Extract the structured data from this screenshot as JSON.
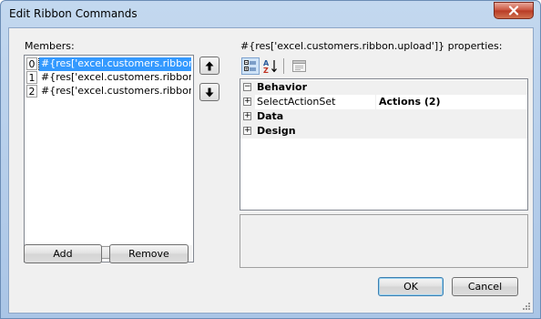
{
  "window": {
    "title": "Edit Ribbon Commands"
  },
  "members": {
    "label": "Members:",
    "items": [
      {
        "index": "0",
        "text": "#{res['excel.customers.ribbon.upl"
      },
      {
        "index": "1",
        "text": "#{res['excel.customers.ribbon.del"
      },
      {
        "index": "2",
        "text": "#{res['excel.customers.ribbon.dov"
      }
    ],
    "selected_index": 0
  },
  "buttons": {
    "add": "Add",
    "remove": "Remove",
    "ok": "OK",
    "cancel": "Cancel"
  },
  "properties": {
    "header": "#{res['excel.customers.ribbon.upload']} properties:",
    "categories": [
      {
        "label": "Behavior",
        "expanded": true
      },
      {
        "label": "Data",
        "expanded": false
      },
      {
        "label": "Design",
        "expanded": false
      }
    ],
    "rows": [
      {
        "name": "SelectActionSet",
        "value": "Actions (2)"
      }
    ]
  },
  "icons": {
    "move_up": "arrow-up-icon",
    "move_down": "arrow-down-icon",
    "categorized": "categorized-icon",
    "alphabetical": "alphabetical-sort-icon",
    "property_pages": "property-pages-icon",
    "close": "close-icon"
  },
  "colors": {
    "selection": "#3399ff",
    "titlebar": "#c3d8ef",
    "close_button": "#c8503a"
  }
}
